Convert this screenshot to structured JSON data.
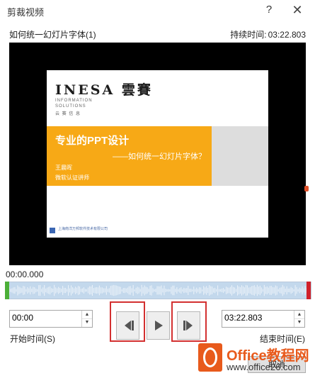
{
  "window": {
    "title": "剪裁视频",
    "help_label": "?",
    "close_label": "✕"
  },
  "video": {
    "name": "如何统一幻灯片字体(1)",
    "duration_label": "持续时间:",
    "duration_value": "03:22.803",
    "current_time": "00:00.000"
  },
  "slide": {
    "logo_text": "INESA 雲賽",
    "logo_sub1": "INFORMATION",
    "logo_sub2": "SOLUTIONS",
    "logo_sub3": "云 赛 信 息",
    "title": "专业的PPT设计",
    "subtitle": "——如何统一幻灯片字体？",
    "author": "王晨晖",
    "author_role": "微软认证讲师",
    "footer": "上海南洋万邦软件技术有限公司"
  },
  "controls": {
    "start_time": "00:00",
    "end_time": "03:22.803",
    "start_label": "开始时间(S)",
    "end_label": "结束时间(E)",
    "cancel_label": "取消"
  },
  "watermark": {
    "brand": "Office教程网",
    "url": "www.office26.com"
  },
  "colors": {
    "trim_bar": "#c3d8ec",
    "start_marker": "#4caf38",
    "end_marker": "#d0212a",
    "highlight": "#d33030",
    "slide_band": "#f7a916"
  }
}
